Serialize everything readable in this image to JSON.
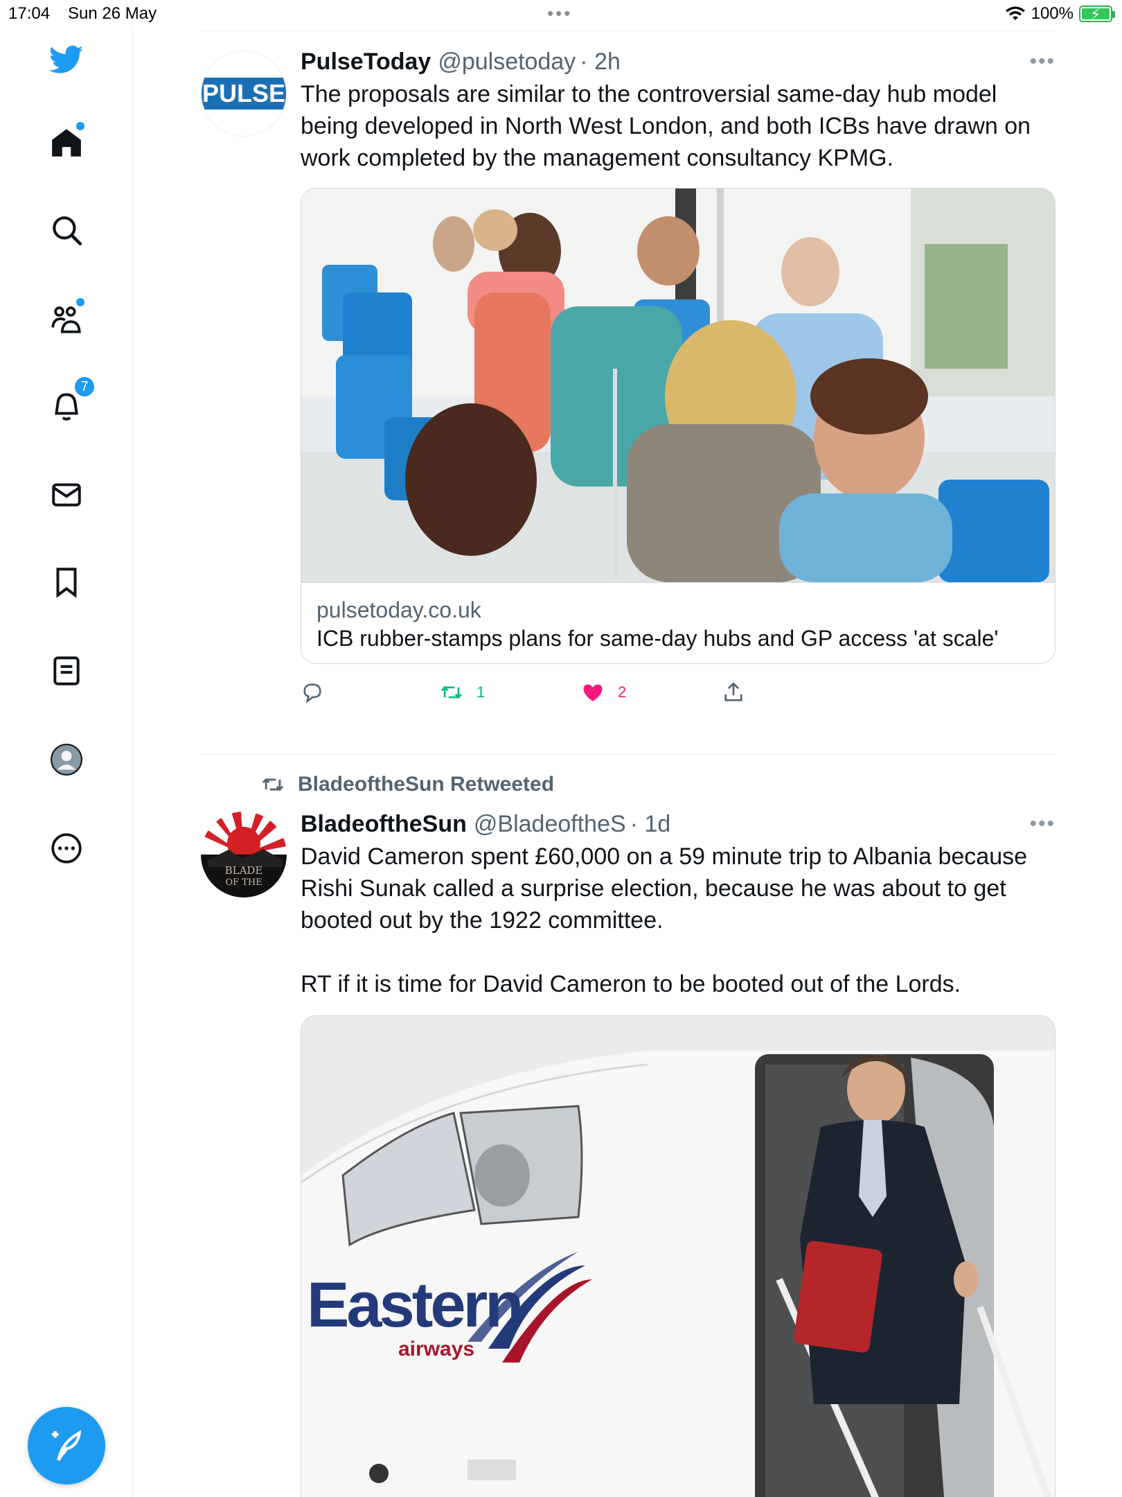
{
  "status_bar": {
    "time": "17:04",
    "date": "Sun 26 May",
    "battery_text": "100%",
    "battery_level": 1.0
  },
  "sidebar": {
    "items": [
      {
        "name": "twitter-logo-icon"
      },
      {
        "name": "home-icon"
      },
      {
        "name": "search-icon"
      },
      {
        "name": "communities-icon"
      },
      {
        "name": "notifications-icon"
      },
      {
        "name": "messages-icon"
      },
      {
        "name": "bookmarks-icon"
      },
      {
        "name": "lists-icon"
      },
      {
        "name": "profile-icon"
      },
      {
        "name": "more-icon"
      }
    ],
    "notifications_badge": "7",
    "compose_icon": "feather-plus-icon"
  },
  "tweets": [
    {
      "author_name": "PulseToday",
      "handle": "@pulsetoday",
      "time": "· 2h",
      "avatar_text": "PULSE",
      "text": "The proposals are similar to the controversial same-day hub model being developed in North West London, and both ICBs have drawn on work completed by the management consultancy KPMG.",
      "card": {
        "domain": "pulsetoday.co.uk",
        "title": "ICB rubber-stamps plans for same-day hubs and GP access 'at scale'"
      },
      "retweets": "1",
      "likes": "2",
      "colors": {
        "retweet": "#00ba7c",
        "like": "#f91880"
      }
    },
    {
      "retweeted_by": "BladeoftheSun Retweeted",
      "author_name": "BladeoftheSun",
      "handle": "@BladeoftheS",
      "time": "· 1d",
      "text_p1": "David Cameron spent £60,000 on a 59 minute trip to Albania because Rishi Sunak called a surprise election, because he was about to get booted out by the 1922 committee.",
      "text_p2": "RT if it is time for David Cameron to be booted out of the Lords.",
      "image_brand": "Eastern",
      "image_brand_sub": "airways"
    }
  ],
  "colors": {
    "accent": "#1d9bf0",
    "text": "#0f1419",
    "muted": "#536471",
    "border": "#e6ecf0"
  }
}
